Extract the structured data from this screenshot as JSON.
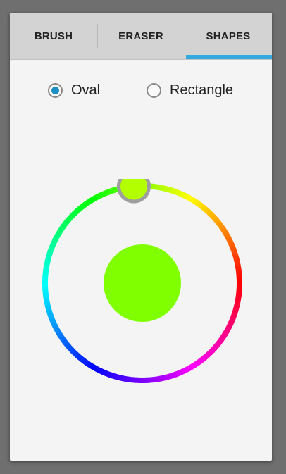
{
  "tabs": [
    {
      "label": "BRUSH",
      "selected": false
    },
    {
      "label": "ERASER",
      "selected": false
    },
    {
      "label": "SHAPES",
      "selected": true
    }
  ],
  "colors": {
    "tab_indicator": "#33a9e0",
    "selected_color": "#80ff00",
    "thumb_color": "#b3ff00",
    "radio_checked": "#1e8fc4"
  },
  "shape_options": [
    {
      "label": "Oval",
      "checked": true
    },
    {
      "label": "Rectangle",
      "checked": false
    }
  ],
  "color_picker": {
    "hue_degrees": 90,
    "thumb_angle_degrees": 95
  }
}
